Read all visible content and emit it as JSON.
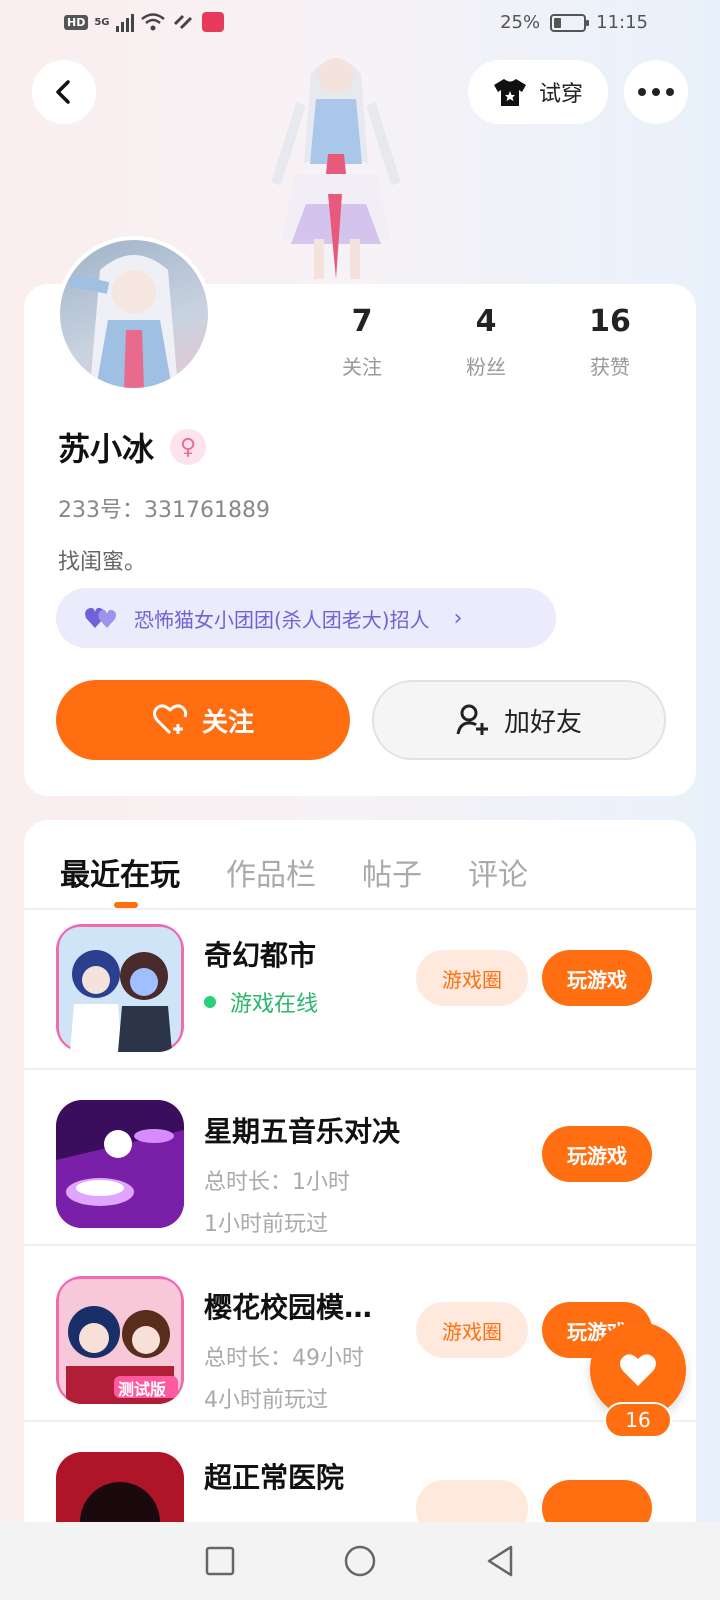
{
  "status_bar": {
    "left_hd": "HD",
    "left_net": "5G",
    "battery_percent": "25%",
    "battery_level": 0.25,
    "time": "11:15"
  },
  "header": {
    "try_on_label": "试穿",
    "icons": [
      "back-arrow-icon",
      "tshirt-icon",
      "more-dots-icon"
    ]
  },
  "profile": {
    "stats": [
      {
        "value": "7",
        "label": "关注"
      },
      {
        "value": "4",
        "label": "粉丝"
      },
      {
        "value": "16",
        "label": "获赞"
      }
    ],
    "username": "苏小冰",
    "gender_symbol": "♀",
    "id_line": "233号：331761889",
    "bio": "找闺蜜。",
    "team_label": "恐怖猫女小团团(杀人团老大)招人",
    "follow_label": "关注",
    "add_friend_label": "加好友"
  },
  "tabs": [
    {
      "label": "最近在玩",
      "active": true
    },
    {
      "label": "作品栏",
      "active": false
    },
    {
      "label": "帖子",
      "active": false
    },
    {
      "label": "评论",
      "active": false
    }
  ],
  "games": [
    {
      "title": "奇幻都市",
      "status": "游戏在线",
      "circle_label": "游戏圈",
      "play_label": "玩游戏"
    },
    {
      "title": "星期五音乐对决",
      "duration": "总时长：1小时",
      "last_played": "1小时前玩过",
      "play_label": "玩游戏"
    },
    {
      "title": "樱花校园模…",
      "duration": "总时长：49小时",
      "last_played": "4小时前玩过",
      "circle_label": "游戏圈",
      "play_label": "玩游戏",
      "icon_badge": "测试版"
    },
    {
      "title": "超正常医院"
    }
  ],
  "likes": {
    "count": "16"
  },
  "colors": {
    "accent": "#ff6f12",
    "online": "#27b86a",
    "team": "#6f62d8"
  }
}
